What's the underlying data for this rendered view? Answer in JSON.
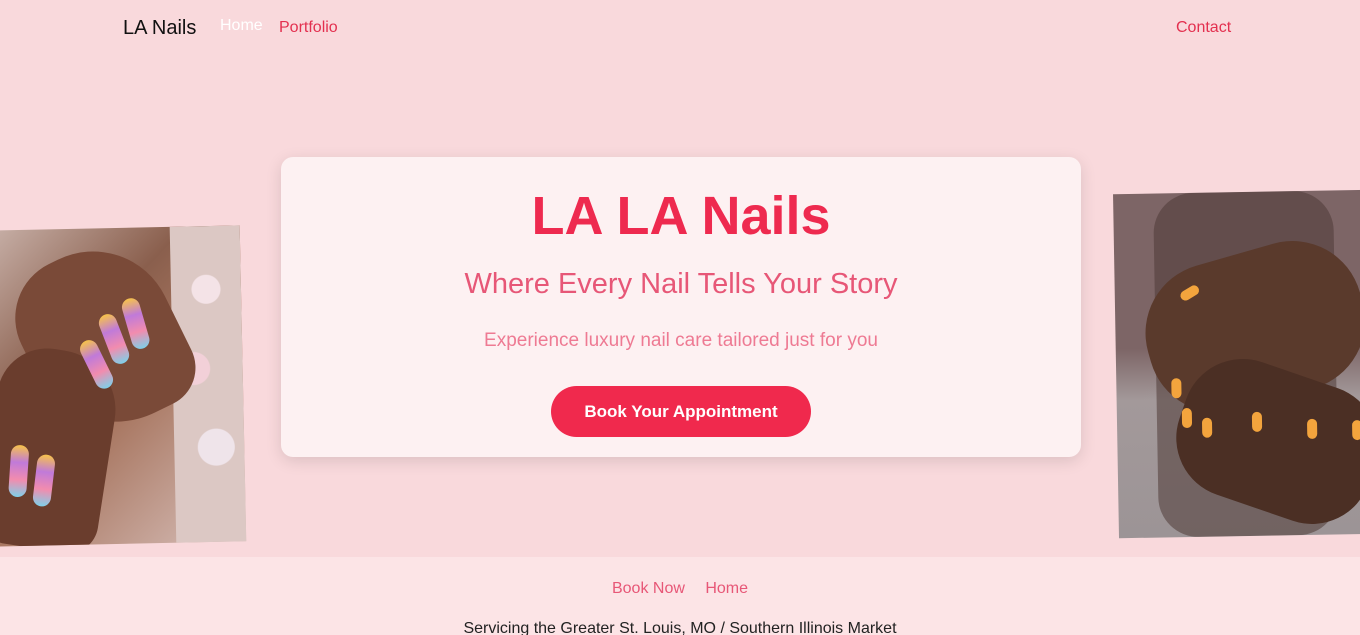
{
  "nav": {
    "brand": "LA Nails",
    "home": "Home",
    "portfolio": "Portfolio",
    "contact": "Contact"
  },
  "hero": {
    "title": "LA LA Nails",
    "subtitle": "Where Every Nail Tells Your Story",
    "tagline": "Experience luxury nail care tailored just for you",
    "cta": "Book Your Appointment"
  },
  "footer": {
    "links": [
      "Book Now",
      "Home"
    ],
    "service_area": "Servicing the Greater St. Louis, MO / Southern Illinois Market"
  },
  "colors": {
    "background": "#f9d9dc",
    "accent": "#f0294d",
    "card": "#fdf1f2",
    "footer": "#fce4e6"
  }
}
